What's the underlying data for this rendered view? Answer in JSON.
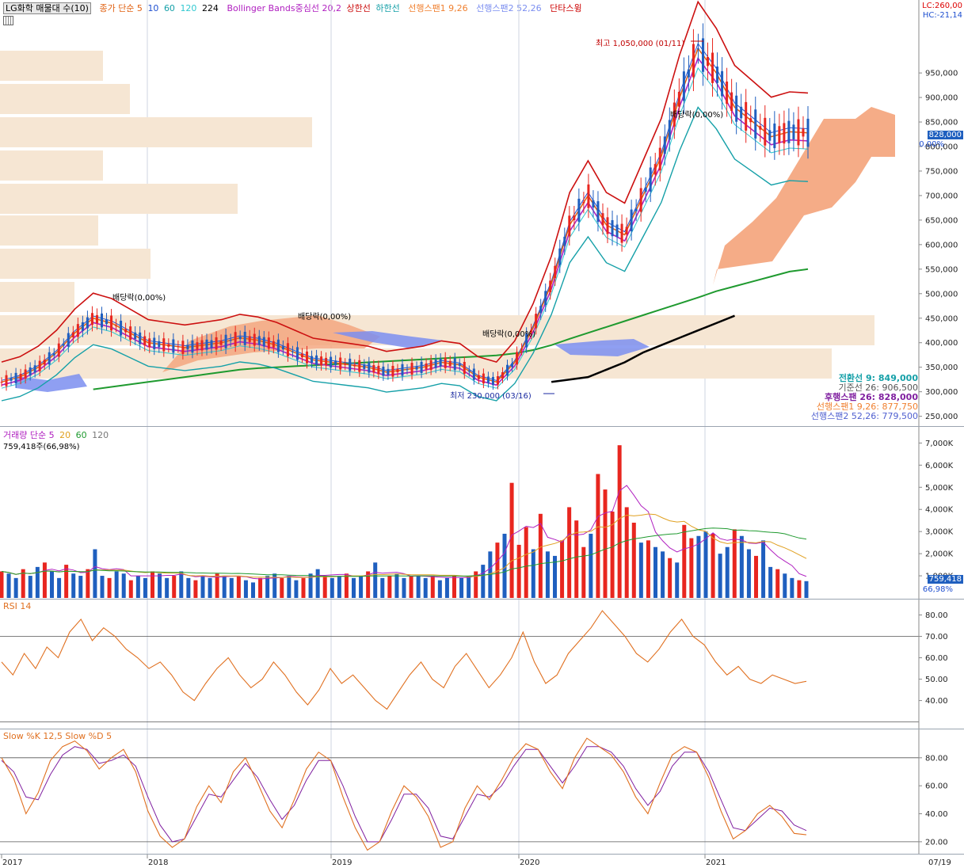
{
  "legend": {
    "title": "LG화학 매물대 수(10)",
    "ma_label": "종가 단순 5",
    "ma10": "10",
    "ma60": "60",
    "ma120": "120",
    "ma224": "224",
    "bb": "Bollinger Bands중심선 20,2",
    "upper": "상한선",
    "lower": "하한선",
    "span1": "선행스팬1 9,26",
    "span2": "선행스팬2 52,26",
    "swing": "단타스윙",
    "lc": "LC:260,00",
    "hc": "HC:-21,14"
  },
  "price_annotations": {
    "high": "최고 1,050,000 (01/11)",
    "low": "최저 230,000 (03/16)",
    "dividend": "배당락(0,00%)",
    "current_price": "828,000",
    "current_pct": "0,00%"
  },
  "ichimoku_values": {
    "tenkan": "전환선 9: 849,000",
    "kijun": "기준선 26: 906,500",
    "chikou": "후행스팬 26: 828,000",
    "span1": "선행스팬1 9,26: 877,750",
    "span2": "선행스팬2 52,26: 779,500"
  },
  "volume_panel": {
    "legend_label": "거래량 단순 5",
    "ma20": "20",
    "ma60": "60",
    "ma120": "120",
    "current": "759,418주(66,98%)",
    "box_value": "759,418",
    "box_pct": "66,98%"
  },
  "rsi_panel": {
    "label": "RSI 14"
  },
  "stoch_panel": {
    "label": "Slow %K 12,5  Slow %D 5"
  },
  "x_axis": {
    "labels": [
      "2017",
      "2018",
      "2019",
      "2020",
      "2021",
      "07/19"
    ]
  },
  "colors": {
    "up": "#e8261f",
    "down": "#1f5fbf",
    "volume_profile": "#f6e6d3",
    "cloud_up": "#f4a37a",
    "cloud_down": "#7b8ef0",
    "bb_mid": "#b020c0",
    "bb_band": "#cc1010",
    "ma5": "#e06010",
    "ma10": "#2050d0",
    "ma60": "#15a0a8",
    "ma120": "#30c8d0",
    "ma224": "#1f9a2f",
    "chikou": "#000000",
    "rsi": "#e07020",
    "stoch_d": "#8020a0"
  },
  "chart_data": [
    {
      "type": "line",
      "name": "price",
      "x_labels": [
        "2017",
        "2018",
        "2019",
        "2020",
        "2021",
        "07/19"
      ],
      "y_ticks": [
        250000,
        300000,
        350000,
        400000,
        450000,
        500000,
        550000,
        600000,
        650000,
        700000,
        750000,
        800000,
        850000,
        900000,
        950000
      ],
      "ylim": [
        230000,
        1060000
      ],
      "series": [
        {
          "name": "종가",
          "values": [
            320000,
            330000,
            350000,
            380000,
            420000,
            450000,
            440000,
            420000,
            400000,
            395000,
            390000,
            395000,
            400000,
            410000,
            405000,
            395000,
            380000,
            365000,
            360000,
            355000,
            350000,
            340000,
            345000,
            350000,
            360000,
            355000,
            330000,
            320000,
            360000,
            430000,
            520000,
            640000,
            700000,
            640000,
            620000,
            700000,
            780000,
            900000,
            1000000,
            950000,
            880000,
            850000,
            820000,
            830000,
            828000
          ]
        },
        {
          "name": "224",
          "values": [
            null,
            null,
            null,
            null,
            null,
            305000,
            310000,
            315000,
            320000,
            325000,
            330000,
            335000,
            340000,
            345000,
            348000,
            350000,
            352000,
            354000,
            356000,
            358000,
            360000,
            362000,
            364000,
            366000,
            368000,
            370000,
            372000,
            374000,
            378000,
            385000,
            395000,
            408000,
            420000,
            432000,
            444000,
            456000,
            468000,
            480000,
            492000,
            505000,
            515000,
            525000,
            535000,
            545000,
            550000
          ]
        }
      ]
    },
    {
      "type": "bar",
      "name": "volume",
      "y_ticks": [
        1000,
        2000,
        3000,
        4000,
        5000,
        6000,
        7000
      ],
      "unit": "K",
      "ylim": [
        0,
        7300
      ],
      "values": [
        1200,
        1100,
        900,
        1300,
        1000,
        1400,
        1600,
        1200,
        900,
        1500,
        1100,
        1000,
        1300,
        2200,
        1000,
        900,
        1200,
        1100,
        800,
        1000,
        900,
        1200,
        1100,
        900,
        1000,
        1200,
        900,
        800,
        1000,
        900,
        1100,
        1000,
        900,
        1000,
        800,
        700,
        900,
        1000,
        1100,
        900,
        1000,
        800,
        900,
        1100,
        1300,
        1000,
        900,
        1000,
        1100,
        900,
        1000,
        1200,
        1600,
        900,
        1000,
        1100,
        900,
        1000,
        1000,
        900,
        1000,
        800,
        900,
        1000,
        900,
        1000,
        1200,
        1500,
        2100,
        2500,
        2900,
        5200,
        2400,
        3200,
        2200,
        3800,
        2100,
        1900,
        2600,
        4100,
        3500,
        2300,
        2900,
        5600,
        4900,
        3900,
        6900,
        4100,
        3400,
        2500,
        2600,
        2300,
        2100,
        1800,
        1600,
        3300,
        2700,
        2800,
        3000,
        2900,
        2000,
        2300,
        3100,
        2800,
        2200,
        1900,
        2600,
        1400,
        1300,
        1100,
        900,
        800,
        759
      ]
    },
    {
      "type": "line",
      "name": "RSI 14",
      "y_ticks": [
        40,
        50,
        60,
        70,
        80
      ],
      "ylim": [
        28,
        85
      ],
      "values": [
        58,
        52,
        62,
        55,
        65,
        60,
        72,
        78,
        68,
        74,
        70,
        64,
        60,
        55,
        58,
        52,
        44,
        40,
        48,
        55,
        60,
        52,
        46,
        50,
        58,
        52,
        44,
        38,
        45,
        55,
        48,
        52,
        46,
        40,
        36,
        44,
        52,
        58,
        50,
        46,
        56,
        62,
        54,
        46,
        52,
        60,
        72,
        58,
        48,
        52,
        62,
        68,
        74,
        82,
        76,
        70,
        62,
        58,
        64,
        72,
        78,
        70,
        66,
        58,
        52,
        56,
        50,
        48,
        52,
        50,
        48,
        49
      ]
    },
    {
      "type": "line",
      "name": "Slow Stochastic",
      "y_ticks": [
        20,
        40,
        60,
        80
      ],
      "ylim": [
        12,
        98
      ],
      "series": [
        {
          "name": "Slow %K 12,5",
          "values": [
            80,
            65,
            40,
            55,
            78,
            88,
            92,
            85,
            72,
            80,
            86,
            70,
            42,
            24,
            16,
            22,
            45,
            60,
            48,
            70,
            80,
            62,
            42,
            30,
            50,
            72,
            84,
            78,
            52,
            30,
            14,
            20,
            42,
            60,
            52,
            38,
            16,
            20,
            44,
            60,
            50,
            64,
            80,
            90,
            86,
            70,
            58,
            80,
            94,
            88,
            82,
            70,
            52,
            40,
            62,
            82,
            88,
            84,
            66,
            42,
            22,
            28,
            40,
            46,
            38,
            26,
            25
          ]
        },
        {
          "name": "Slow %D 5",
          "values": [
            78,
            70,
            52,
            50,
            68,
            82,
            88,
            86,
            76,
            78,
            82,
            74,
            52,
            32,
            20,
            22,
            38,
            54,
            52,
            64,
            76,
            66,
            50,
            36,
            46,
            64,
            78,
            78,
            60,
            38,
            20,
            20,
            36,
            54,
            54,
            44,
            24,
            22,
            38,
            54,
            52,
            60,
            74,
            86,
            86,
            74,
            62,
            74,
            88,
            88,
            84,
            74,
            58,
            46,
            56,
            74,
            84,
            84,
            70,
            50,
            30,
            28,
            36,
            44,
            42,
            32,
            28
          ]
        }
      ]
    }
  ]
}
